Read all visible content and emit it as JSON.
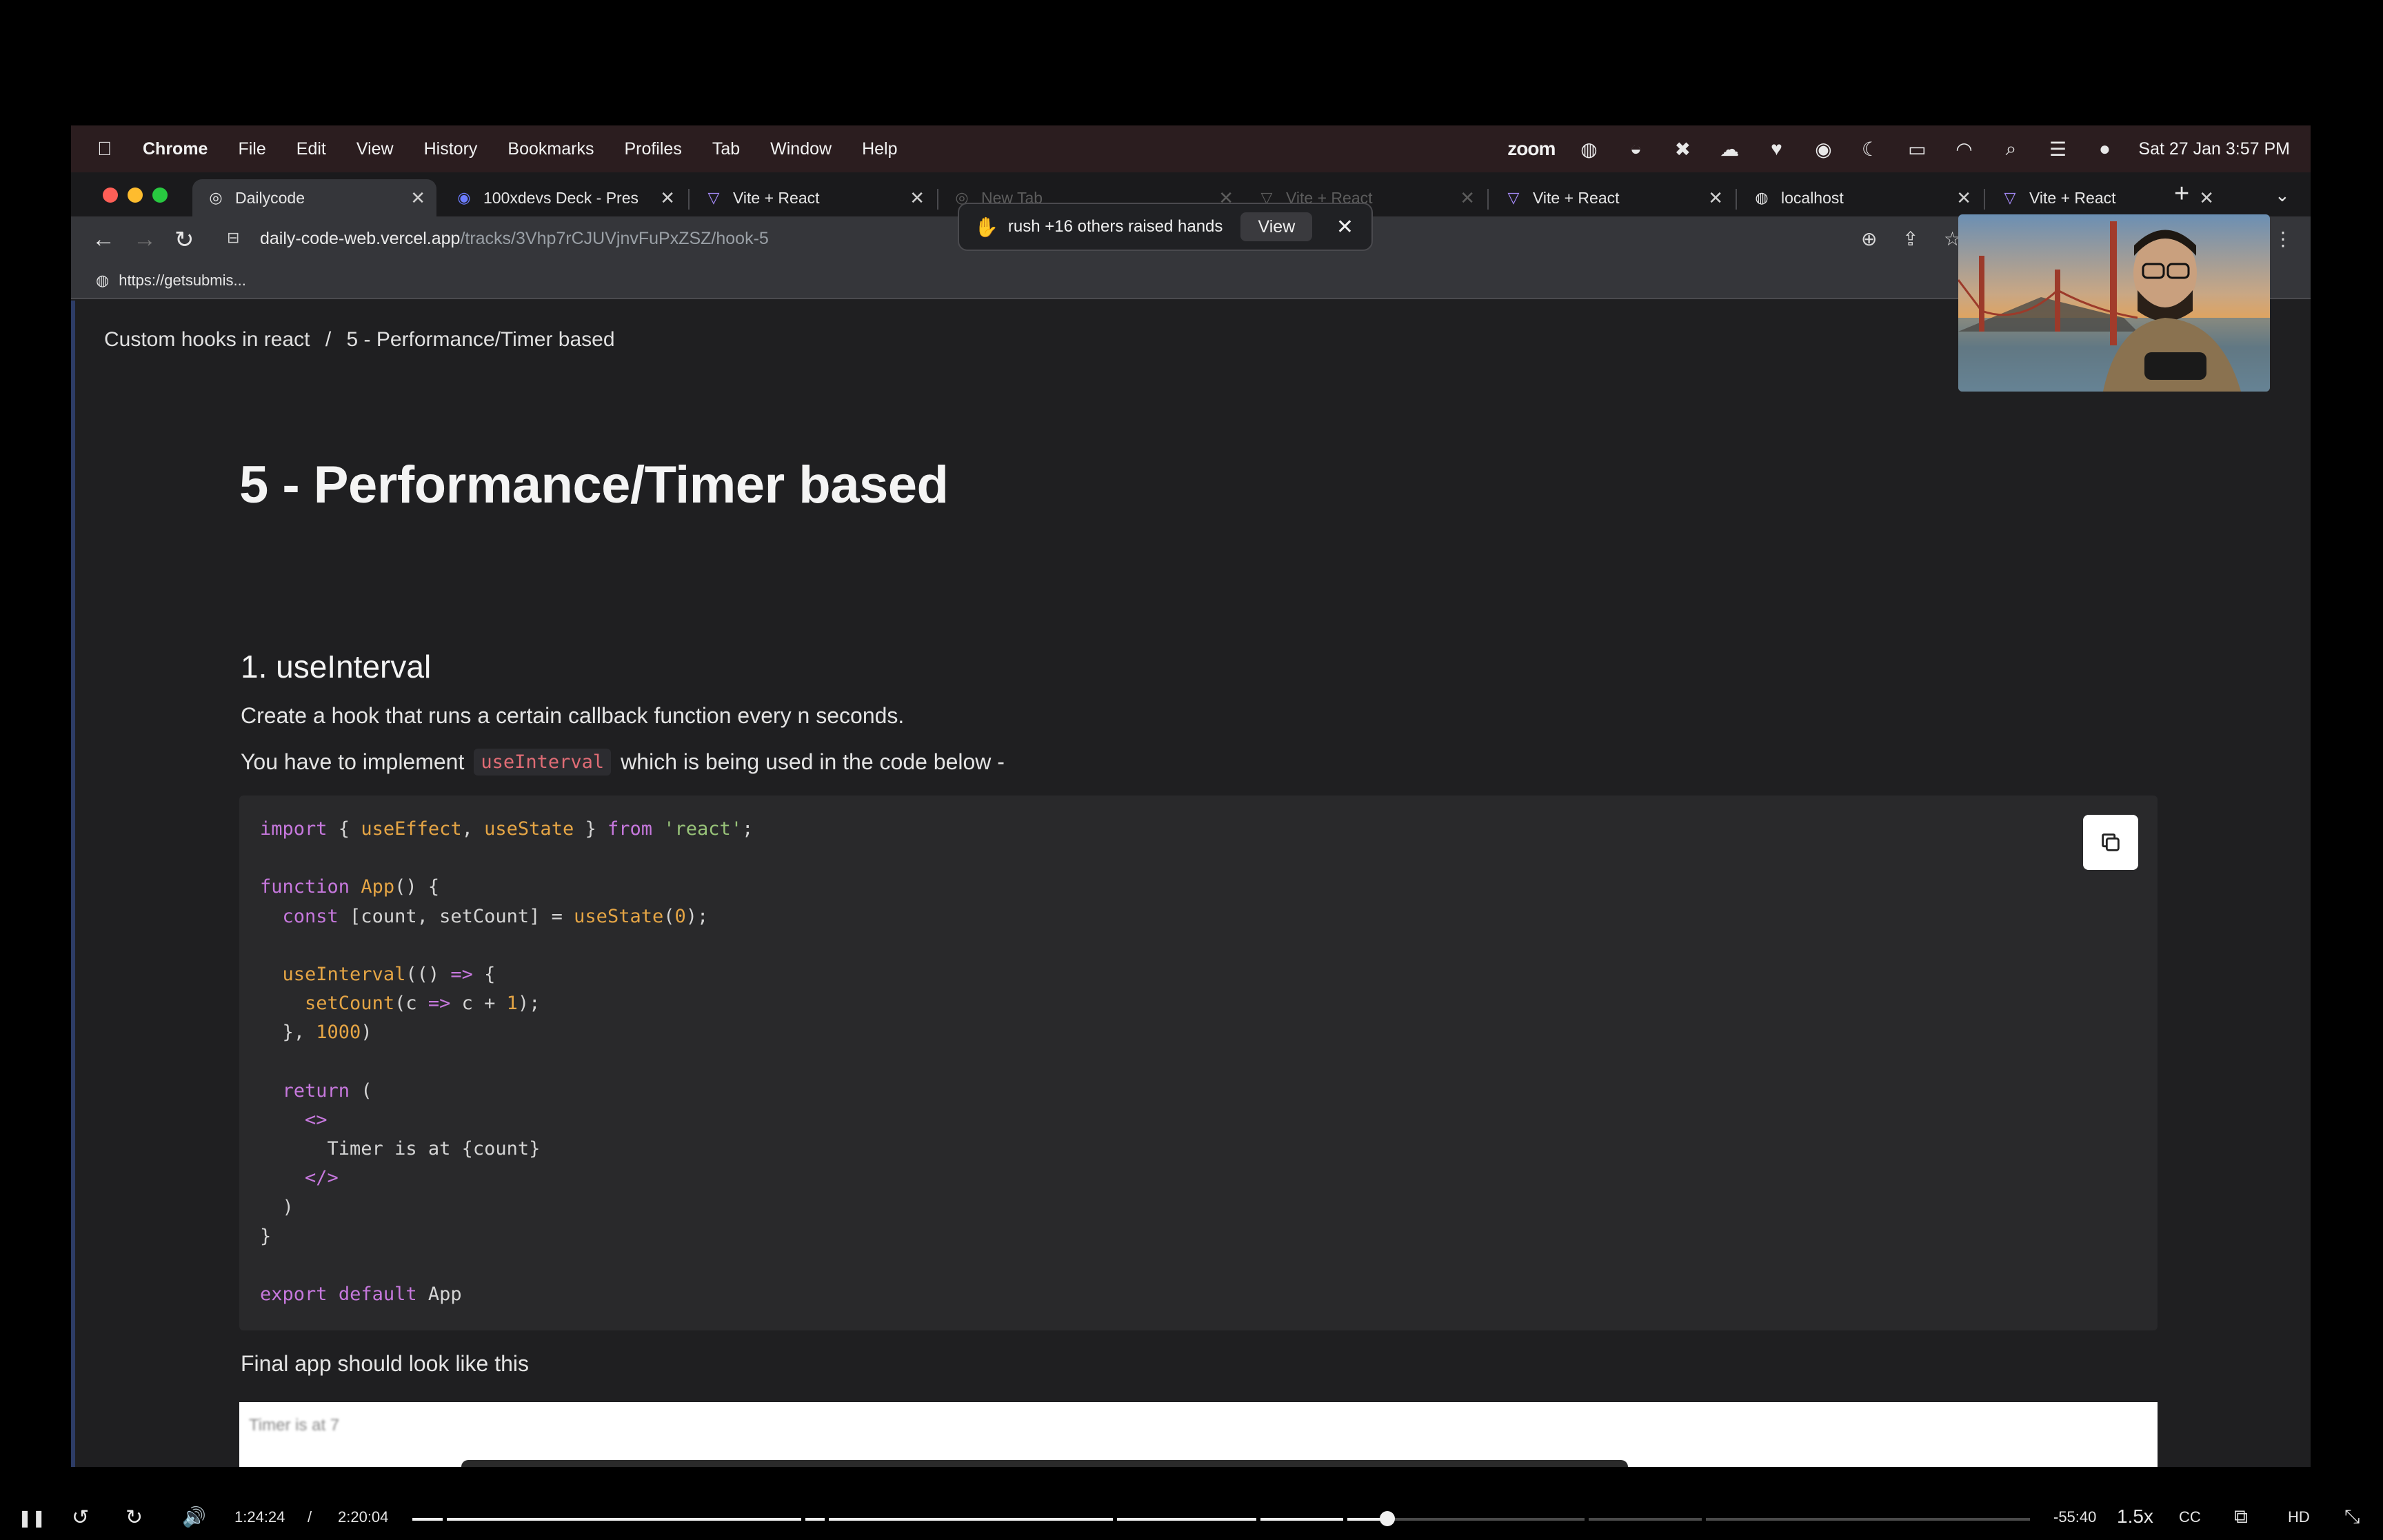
{
  "menubar": {
    "apple": "",
    "items": [
      "Chrome",
      "File",
      "Edit",
      "View",
      "History",
      "Bookmarks",
      "Profiles",
      "Tab",
      "Window",
      "Help"
    ],
    "zoom_label": "zoom",
    "datetime": "Sat 27 Jan  3:57 PM"
  },
  "tabs": [
    {
      "label": "Dailycode",
      "favicon": "◎"
    },
    {
      "label": "100xdevs Deck - Pres",
      "favicon": "◉"
    },
    {
      "label": "Vite + React",
      "favicon": "▽"
    },
    {
      "label": "New Tab",
      "favicon": "◎"
    },
    {
      "label": "Vite + React",
      "favicon": "▽"
    },
    {
      "label": "Vite + React",
      "favicon": "▽"
    },
    {
      "label": "localhost",
      "favicon": "◍"
    },
    {
      "label": "Vite + React",
      "favicon": "▽"
    }
  ],
  "toolbar": {
    "url_host": "daily-code-web.vercel.app",
    "url_path": "/tracks/3Vhp7rCJUVjnvFuPxZSZ/hook-5"
  },
  "bookmarks": [
    {
      "label": "https://getsubmis..."
    }
  ],
  "notification": {
    "message": "rush +16 others raised hands",
    "view_label": "View"
  },
  "page": {
    "breadcrumb": {
      "parent": "Custom hooks in react",
      "separator": "/",
      "current": "5 - Performance/Timer based"
    },
    "title": "5 - Performance/Timer based",
    "section_title": "1.  useInterval",
    "desc_1": "Create a hook that runs a certain callback function every n seconds.",
    "desc_2_before": "You have to implement",
    "desc_2_code": "useInterval",
    "desc_2_after": "which is being used in the code below -",
    "final_text": "Final app should look like this",
    "preview_text": "Timer is at 7"
  },
  "code_lines": [
    "import { useEffect, useState } from 'react';",
    "",
    "function App() {",
    "  const [count, setCount] = useState(0);",
    "",
    "  useInterval(() => {",
    "    setCount(c => c + 1);",
    "  }, 1000)",
    "",
    "  return (",
    "    <>",
    "      Timer is at {count}",
    "    </>",
    "  )",
    "}",
    "",
    "export default App"
  ],
  "player": {
    "current_time": "1:24:24",
    "separator": "/",
    "duration": "2:20:04",
    "remaining": "-55:40",
    "speed": "1.5x",
    "progress": 0.6026
  },
  "colors": {
    "keyword": "#c678dd",
    "function": "#e5a545",
    "string": "#98c379",
    "number": "#e5a545",
    "accent_code": "#e06c75"
  }
}
